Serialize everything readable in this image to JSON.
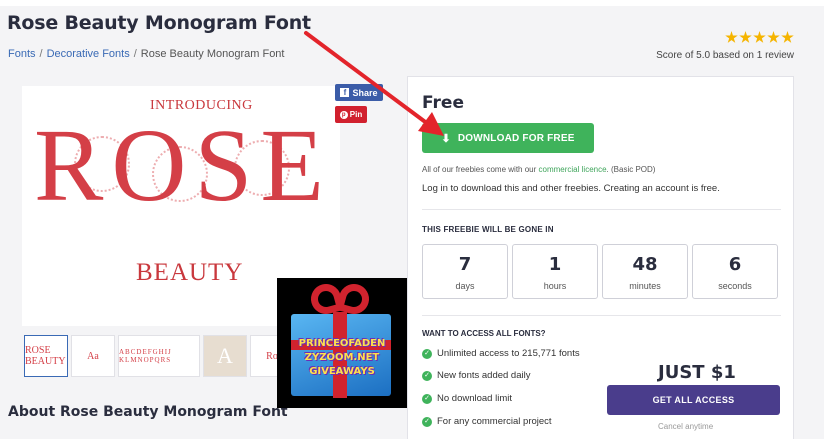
{
  "header": {
    "title": "Rose Beauty Monogram Font",
    "breadcrumb": [
      "Fonts",
      "Decorative Fonts",
      "Rose Beauty Monogram Font"
    ]
  },
  "rating": {
    "stars": 5,
    "text": "Score of 5.0 based on 1 review",
    "star_color": "#f5b400"
  },
  "preview": {
    "intro": "INTRODUCING",
    "word": "ROSE",
    "sub": "BEAUTY",
    "accent": "#d43f47"
  },
  "social": {
    "share_label": "Share",
    "fb_icon": "f",
    "pin_label": "Pin",
    "pin_icon": "p"
  },
  "thumbnails": [
    "ROSE BEAUTY",
    "Aa",
    "ABCDEFGHIJ KLMNOPQRS",
    "A",
    "Ro"
  ],
  "about_heading": "About Rose Beauty Monogram Font",
  "gift": {
    "lines": [
      "PRINCEOFADEN",
      "ZYZOOM.NET",
      "GIVEAWAYS"
    ]
  },
  "panel": {
    "price": "Free",
    "download_label": "DOWNLOAD FOR FREE",
    "licence_prefix": "All of our freebies come with our",
    "licence_link": "commercial licence",
    "licence_suffix": ". (Basic POD)",
    "login_note": "Log in to download this and other freebies. Creating an account is free.",
    "gone_heading": "THIS FREEBIE WILL BE GONE IN",
    "countdown": [
      {
        "value": "7",
        "unit": "days"
      },
      {
        "value": "1",
        "unit": "hours"
      },
      {
        "value": "48",
        "unit": "minutes"
      },
      {
        "value": "6",
        "unit": "seconds"
      }
    ],
    "want_heading": "WANT TO ACCESS ALL FONTS?",
    "features": [
      "Unlimited access to 215,771 fonts",
      "New fonts added daily",
      "No download limit",
      "For any commercial project"
    ],
    "price_all": "JUST $1",
    "access_label": "GET ALL ACCESS",
    "cancel_note": "Cancel anytime",
    "green": "#3fb35b",
    "purple": "#4a3d8c"
  }
}
